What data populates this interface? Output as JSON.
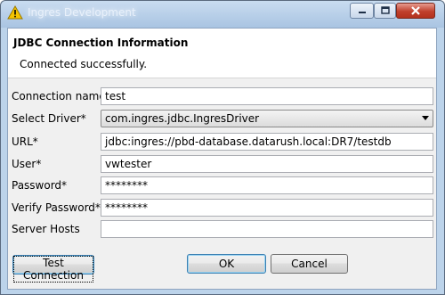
{
  "window": {
    "title": "Ingres Development",
    "minimize_icon": "minimize-icon",
    "maximize_icon": "maximize-icon",
    "close_icon": "close-icon"
  },
  "header": {
    "title": "JDBC Connection Information",
    "message": "Connected successfully."
  },
  "form": {
    "connection_name": {
      "label": "Connection name",
      "value": "test"
    },
    "driver": {
      "label": "Select Driver*",
      "value": "com.ingres.jdbc.IngresDriver"
    },
    "url": {
      "label": "URL*",
      "value": "jdbc:ingres://pbd-database.datarush.local:DR7/testdb"
    },
    "user": {
      "label": "User*",
      "value": "vwtester"
    },
    "password": {
      "label": "Password*",
      "value": "********"
    },
    "verify_password": {
      "label": "Verify Password*",
      "value": "********"
    },
    "server_hosts": {
      "label": "Server Hosts",
      "value": ""
    }
  },
  "buttons": {
    "test_connection": "Test Connection",
    "ok": "OK",
    "cancel": "Cancel"
  },
  "colors": {
    "window_frame": "#bcd3ea",
    "close_button": "#c0402c",
    "focus_border": "#3c7fb1"
  }
}
